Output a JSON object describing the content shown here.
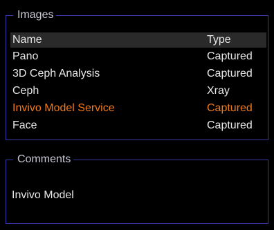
{
  "images": {
    "title": "Images",
    "columns": {
      "name": "Name",
      "type": "Type"
    },
    "rows": [
      {
        "name": "Pano",
        "type": "Captured"
      },
      {
        "name": "3D Ceph Analysis",
        "type": "Captured"
      },
      {
        "name": "Ceph",
        "type": "Xray"
      },
      {
        "name": "Invivo Model Service",
        "type": "Captured"
      },
      {
        "name": "Face",
        "type": "Captured"
      }
    ],
    "selected_row": "Invivo Model Service"
  },
  "comments": {
    "title": "Comments",
    "text": "Invivo Model"
  },
  "colors": {
    "background": "#000000",
    "border": "#3a3aa8",
    "selected_text": "#f07a1a",
    "header_background": "#2a2a2a"
  }
}
